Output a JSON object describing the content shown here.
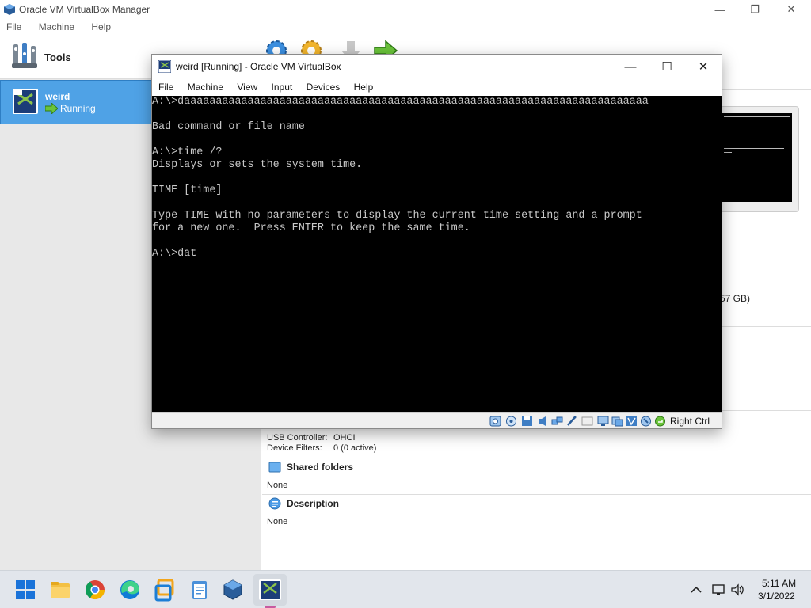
{
  "manager": {
    "title": "Oracle VM VirtualBox Manager",
    "menu": [
      "File",
      "Machine",
      "Help"
    ],
    "tools_label": "Tools",
    "vm": {
      "name": "weird",
      "state": "Running"
    },
    "disk_size_partial": "57 GB)",
    "usb": {
      "controller_label": "USB Controller:",
      "controller_value": "OHCI",
      "filters_label": "Device Filters:",
      "filters_value": "0 (0 active)"
    },
    "shared_folders": {
      "title": "Shared folders",
      "value": "None"
    },
    "description": {
      "title": "Description",
      "value": "None"
    }
  },
  "vm_window": {
    "title": "weird [Running] - Oracle VM VirtualBox",
    "menu": [
      "File",
      "Machine",
      "View",
      "Input",
      "Devices",
      "Help"
    ],
    "console_lines": [
      "A:\\>daaaaaaaaaaaaaaaaaaaaaaaaaaaaaaaaaaaaaaaaaaaaaaaaaaaaaaaaaaaaaaaaaaaaaaaaa",
      "",
      "Bad command or file name",
      "",
      "A:\\>time /?",
      "Displays or sets the system time.",
      "",
      "TIME [time]",
      "",
      "Type TIME with no parameters to display the current time setting and a prompt",
      "for a new one.  Press ENTER to keep the same time.",
      "",
      "A:\\>dat"
    ],
    "host_key": "Right Ctrl"
  },
  "taskbar": {
    "time": "5:11 AM",
    "date": "3/1/2022"
  },
  "colors": {
    "selection": "#4fa2e6",
    "console_bg": "#000000",
    "console_fg": "#c8c8c8",
    "taskbar_bg": "#e2e6ec"
  }
}
